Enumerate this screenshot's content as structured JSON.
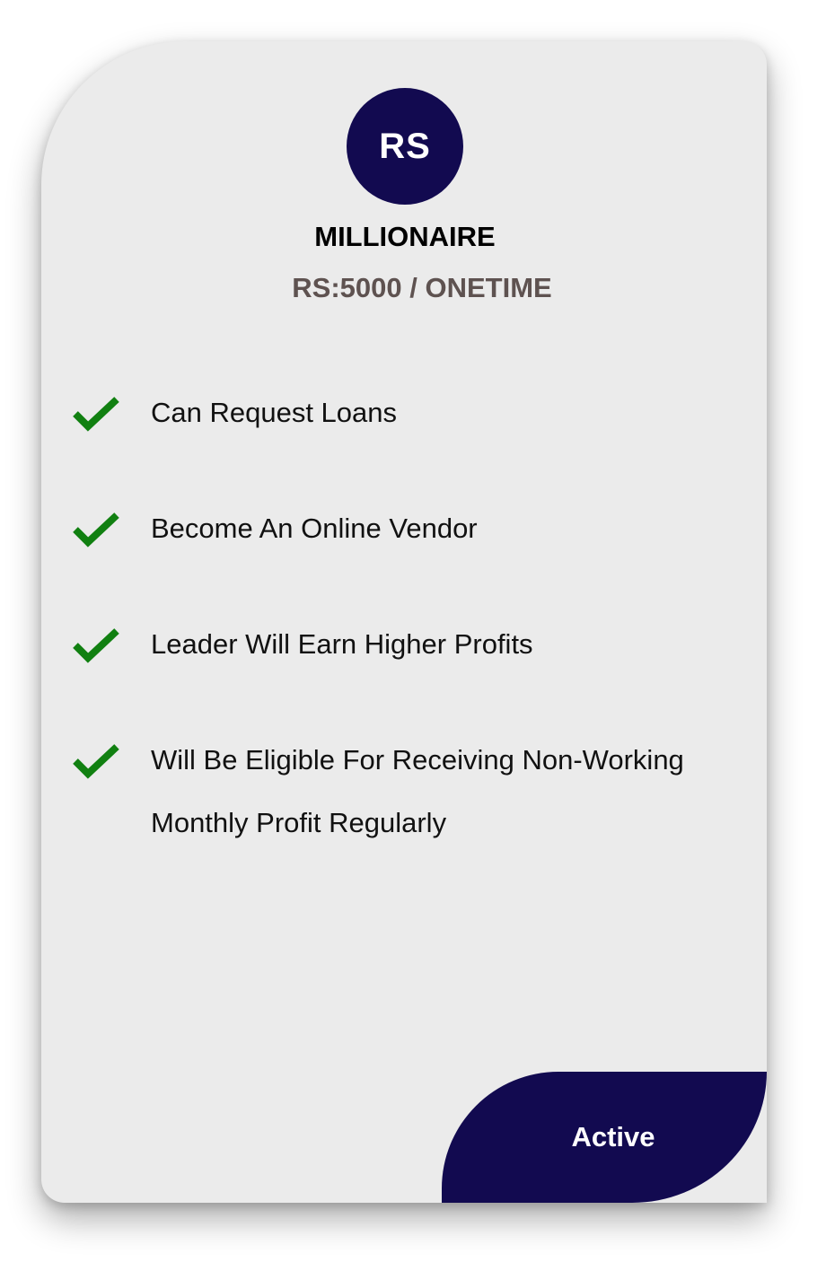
{
  "plan": {
    "avatar_text": "RS",
    "name": "MILLIONAIRE",
    "price": "RS:5000 / ONETIME"
  },
  "features": [
    {
      "label": "Can Request Loans",
      "icon": "checkmark-icon"
    },
    {
      "label": "Become An Online Vendor",
      "icon": "checkmark-icon"
    },
    {
      "label": "Leader Will Earn Higher Profits",
      "icon": "checkmark-icon"
    },
    {
      "label": "Will Be Eligible For Receiving Non-Working Monthly Profit Regularly",
      "icon": "checkmark-icon"
    }
  ],
  "status": {
    "label": "Active"
  },
  "colors": {
    "accent": "#120a50",
    "check": "#118011",
    "card_bg": "#ebebeb",
    "price_text": "#5e5250"
  }
}
